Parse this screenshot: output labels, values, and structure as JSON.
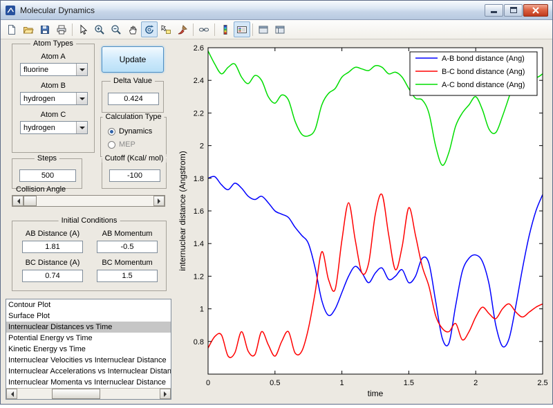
{
  "titlebar": {
    "title": "Molecular Dynamics"
  },
  "toolbar": {
    "items": [
      {
        "name": "new-figure",
        "active": false
      },
      {
        "name": "open-file",
        "active": false
      },
      {
        "name": "save-figure",
        "active": false
      },
      {
        "name": "print-figure",
        "active": false
      },
      {
        "name": "edit-plot",
        "active": false
      },
      {
        "name": "zoom-in",
        "active": false
      },
      {
        "name": "zoom-out",
        "active": false
      },
      {
        "name": "pan",
        "active": false
      },
      {
        "name": "rotate-3d",
        "active": true
      },
      {
        "name": "data-cursor",
        "active": false
      },
      {
        "name": "brush",
        "active": false
      },
      {
        "name": "link-plot",
        "active": false
      },
      {
        "name": "insert-colorbar",
        "active": false
      },
      {
        "name": "insert-legend",
        "active": true
      },
      {
        "name": "hide-plot-tools",
        "active": false
      },
      {
        "name": "show-plot-tools",
        "active": false
      }
    ]
  },
  "panels": {
    "update_label": "Update",
    "atom_types": {
      "title": "Atom Types",
      "fields": [
        {
          "label": "Atom A",
          "value": "fluorine"
        },
        {
          "label": "Atom B",
          "value": "hydrogen"
        },
        {
          "label": "Atom C",
          "value": "hydrogen"
        }
      ]
    },
    "delta": {
      "title": "Delta Value",
      "value": "0.424"
    },
    "calculation_type": {
      "title": "Calculation Type",
      "options": [
        {
          "label": "Dynamics",
          "selected": true,
          "enabled": true
        },
        {
          "label": "MEP",
          "selected": false,
          "enabled": false
        }
      ]
    },
    "steps": {
      "title": "Steps",
      "value": "500"
    },
    "cutoff": {
      "title": "Cutoff (Kcal/ mol)",
      "value": "-100"
    },
    "collision_angle": {
      "label": "Collision Angle"
    },
    "initial_conditions": {
      "title": "Initial Conditions",
      "fields": [
        {
          "label": "AB Distance (A)",
          "value": "1.81"
        },
        {
          "label": "AB Momentum",
          "value": "-0.5"
        },
        {
          "label": "BC Distance (A)",
          "value": "0.74"
        },
        {
          "label": "BC Momentum",
          "value": "1.5"
        }
      ]
    },
    "plot_list": {
      "selected_index": 2,
      "items": [
        "Contour Plot",
        "Surface Plot",
        "Internuclear Distances vs Time",
        "Potential Energy vs Time",
        "Kinetic Energy vs Time",
        "Internuclear Velocities vs Internuclear Distance",
        "Internuclear Accelerations vs Internuclear Distance",
        "Internuclear Momenta vs Internuclear Distance"
      ]
    }
  },
  "chart_data": {
    "type": "line",
    "title": "",
    "xlabel": "time",
    "ylabel": "internuclear distance (Angstrom)",
    "xlim": [
      0,
      2.5
    ],
    "ylim": [
      0.6,
      2.6
    ],
    "xticks": [
      0,
      0.5,
      1,
      1.5,
      2,
      2.5
    ],
    "yticks": [
      0.8,
      1,
      1.2,
      1.4,
      1.6,
      1.8,
      2,
      2.2,
      2.4,
      2.6
    ],
    "grid": false,
    "legend_position": "top-right",
    "x": [
      0,
      0.05,
      0.1,
      0.15,
      0.2,
      0.25,
      0.3,
      0.35,
      0.4,
      0.45,
      0.5,
      0.55,
      0.6,
      0.65,
      0.7,
      0.75,
      0.8,
      0.85,
      0.9,
      0.95,
      1,
      1.05,
      1.1,
      1.15,
      1.2,
      1.25,
      1.3,
      1.35,
      1.4,
      1.45,
      1.5,
      1.55,
      1.6,
      1.65,
      1.7,
      1.75,
      1.8,
      1.85,
      1.9,
      1.95,
      2,
      2.05,
      2.1,
      2.15,
      2.2,
      2.25,
      2.3,
      2.35,
      2.4,
      2.45,
      2.5
    ],
    "series": [
      {
        "name": "A-B bond distance (Ang)",
        "color": "#0000ff",
        "values": [
          1.8,
          1.81,
          1.76,
          1.73,
          1.77,
          1.74,
          1.69,
          1.67,
          1.69,
          1.65,
          1.6,
          1.58,
          1.56,
          1.5,
          1.45,
          1.4,
          1.25,
          1.05,
          0.96,
          1.0,
          1.1,
          1.2,
          1.26,
          1.22,
          1.16,
          1.22,
          1.25,
          1.18,
          1.2,
          1.24,
          1.16,
          1.2,
          1.31,
          1.28,
          1.05,
          0.82,
          0.79,
          1.02,
          1.23,
          1.31,
          1.33,
          1.29,
          1.15,
          0.9,
          0.77,
          0.82,
          1.02,
          1.25,
          1.45,
          1.6,
          1.7
        ]
      },
      {
        "name": "B-C bond distance (Ang)",
        "color": "#ff0000",
        "values": [
          0.76,
          0.83,
          0.84,
          0.71,
          0.73,
          0.86,
          0.74,
          0.72,
          0.86,
          0.78,
          0.71,
          0.8,
          0.86,
          0.73,
          0.74,
          0.88,
          1.1,
          1.35,
          1.18,
          1.12,
          1.42,
          1.65,
          1.42,
          1.22,
          1.28,
          1.58,
          1.7,
          1.45,
          1.24,
          1.38,
          1.62,
          1.45,
          1.26,
          1.14,
          0.96,
          0.88,
          0.86,
          0.91,
          0.81,
          0.86,
          0.95,
          1.01,
          0.97,
          0.94,
          1.0,
          1.03,
          0.98,
          0.95,
          0.98,
          1.01,
          1.03
        ]
      },
      {
        "name": "A-C bond distance (Ang)",
        "color": "#00dd00",
        "values": [
          2.58,
          2.5,
          2.44,
          2.48,
          2.5,
          2.42,
          2.38,
          2.43,
          2.4,
          2.3,
          2.26,
          2.31,
          2.28,
          2.15,
          2.07,
          2.06,
          2.1,
          2.25,
          2.32,
          2.35,
          2.42,
          2.45,
          2.48,
          2.47,
          2.46,
          2.49,
          2.48,
          2.44,
          2.45,
          2.42,
          2.35,
          2.29,
          2.28,
          2.2,
          2.0,
          1.88,
          1.96,
          2.12,
          2.2,
          2.25,
          2.3,
          2.22,
          2.1,
          2.08,
          2.18,
          2.3,
          2.42,
          2.5,
          2.48,
          2.42,
          2.44
        ]
      }
    ]
  }
}
